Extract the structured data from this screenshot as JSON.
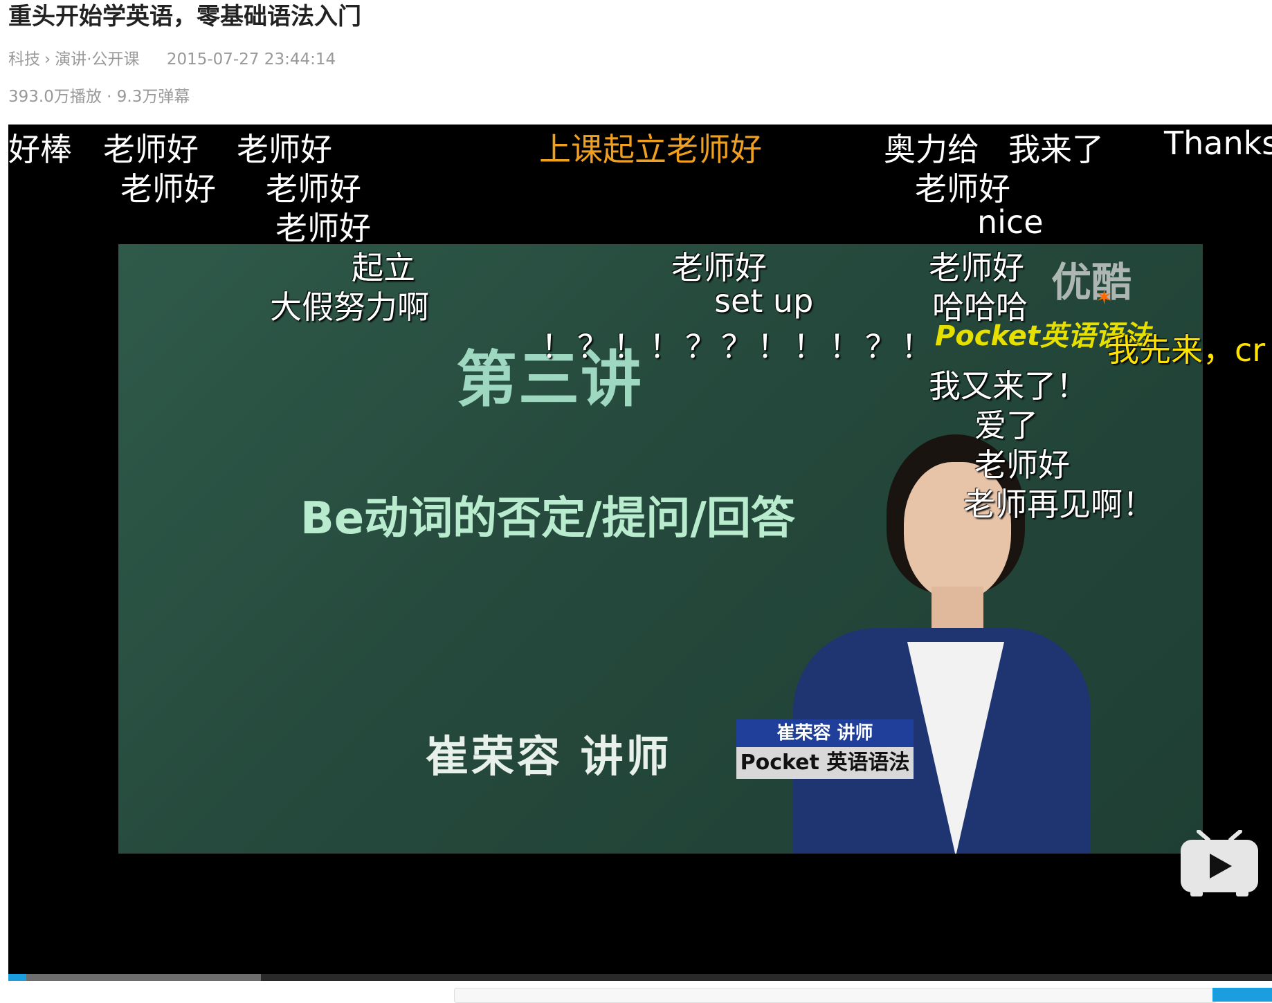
{
  "video": {
    "title": "重头开始学英语，零基础语法入门",
    "breadcrumb": [
      "科技",
      "演讲·公开课"
    ],
    "breadcrumb_separator": "›",
    "upload_date": "2015-07-27 23:44:14",
    "stats": "393.0万播放 · 9.3万弹幕"
  },
  "player": {
    "board": {
      "heading": "第三讲",
      "subtitle": "Be动词的否定/提问/回答",
      "lecturer": "崔荣容  讲师"
    },
    "watermark": {
      "youku": "优酷",
      "pocket": "Pocket英语语法"
    },
    "nameplate": {
      "name": "崔荣容 讲师",
      "brand": "Pocket 英语语法"
    },
    "progress": {
      "played_fraction": 0.014,
      "buffered_fraction": 0.2
    },
    "tv_icon": "bilibili-tv-icon",
    "danmaku": [
      {
        "text": "好棒",
        "color": "white"
      },
      {
        "text": "老师好",
        "color": "white"
      },
      {
        "text": "老师好",
        "color": "white"
      },
      {
        "text": "上课起立老师好",
        "color": "orange"
      },
      {
        "text": "奥力给",
        "color": "white"
      },
      {
        "text": "我来了",
        "color": "white"
      },
      {
        "text": "Thanks",
        "color": "white"
      },
      {
        "text": "老师好",
        "color": "white"
      },
      {
        "text": "老师好",
        "color": "white"
      },
      {
        "text": "老师好",
        "color": "white"
      },
      {
        "text": "老师好",
        "color": "white"
      },
      {
        "text": "nice",
        "color": "white"
      },
      {
        "text": "起立",
        "color": "white"
      },
      {
        "text": "老师好",
        "color": "white"
      },
      {
        "text": "老师好",
        "color": "white"
      },
      {
        "text": "大假努力啊",
        "color": "white"
      },
      {
        "text": "set up",
        "color": "white"
      },
      {
        "text": "哈哈哈",
        "color": "white"
      },
      {
        "text": "！？！！？？！！！？！",
        "color": "white"
      },
      {
        "text": "我先来，cr",
        "color": "yellow"
      },
      {
        "text": "我又来了！",
        "color": "white"
      },
      {
        "text": "爱了",
        "color": "white"
      },
      {
        "text": "老师好",
        "color": "white"
      },
      {
        "text": "老师再见啊！",
        "color": "white"
      }
    ]
  },
  "colors": {
    "danmaku_orange": "#f0a020",
    "danmaku_yellow": "#ffe300",
    "progress_played": "#1a9ee0",
    "board_green": "#2f5a4a"
  }
}
